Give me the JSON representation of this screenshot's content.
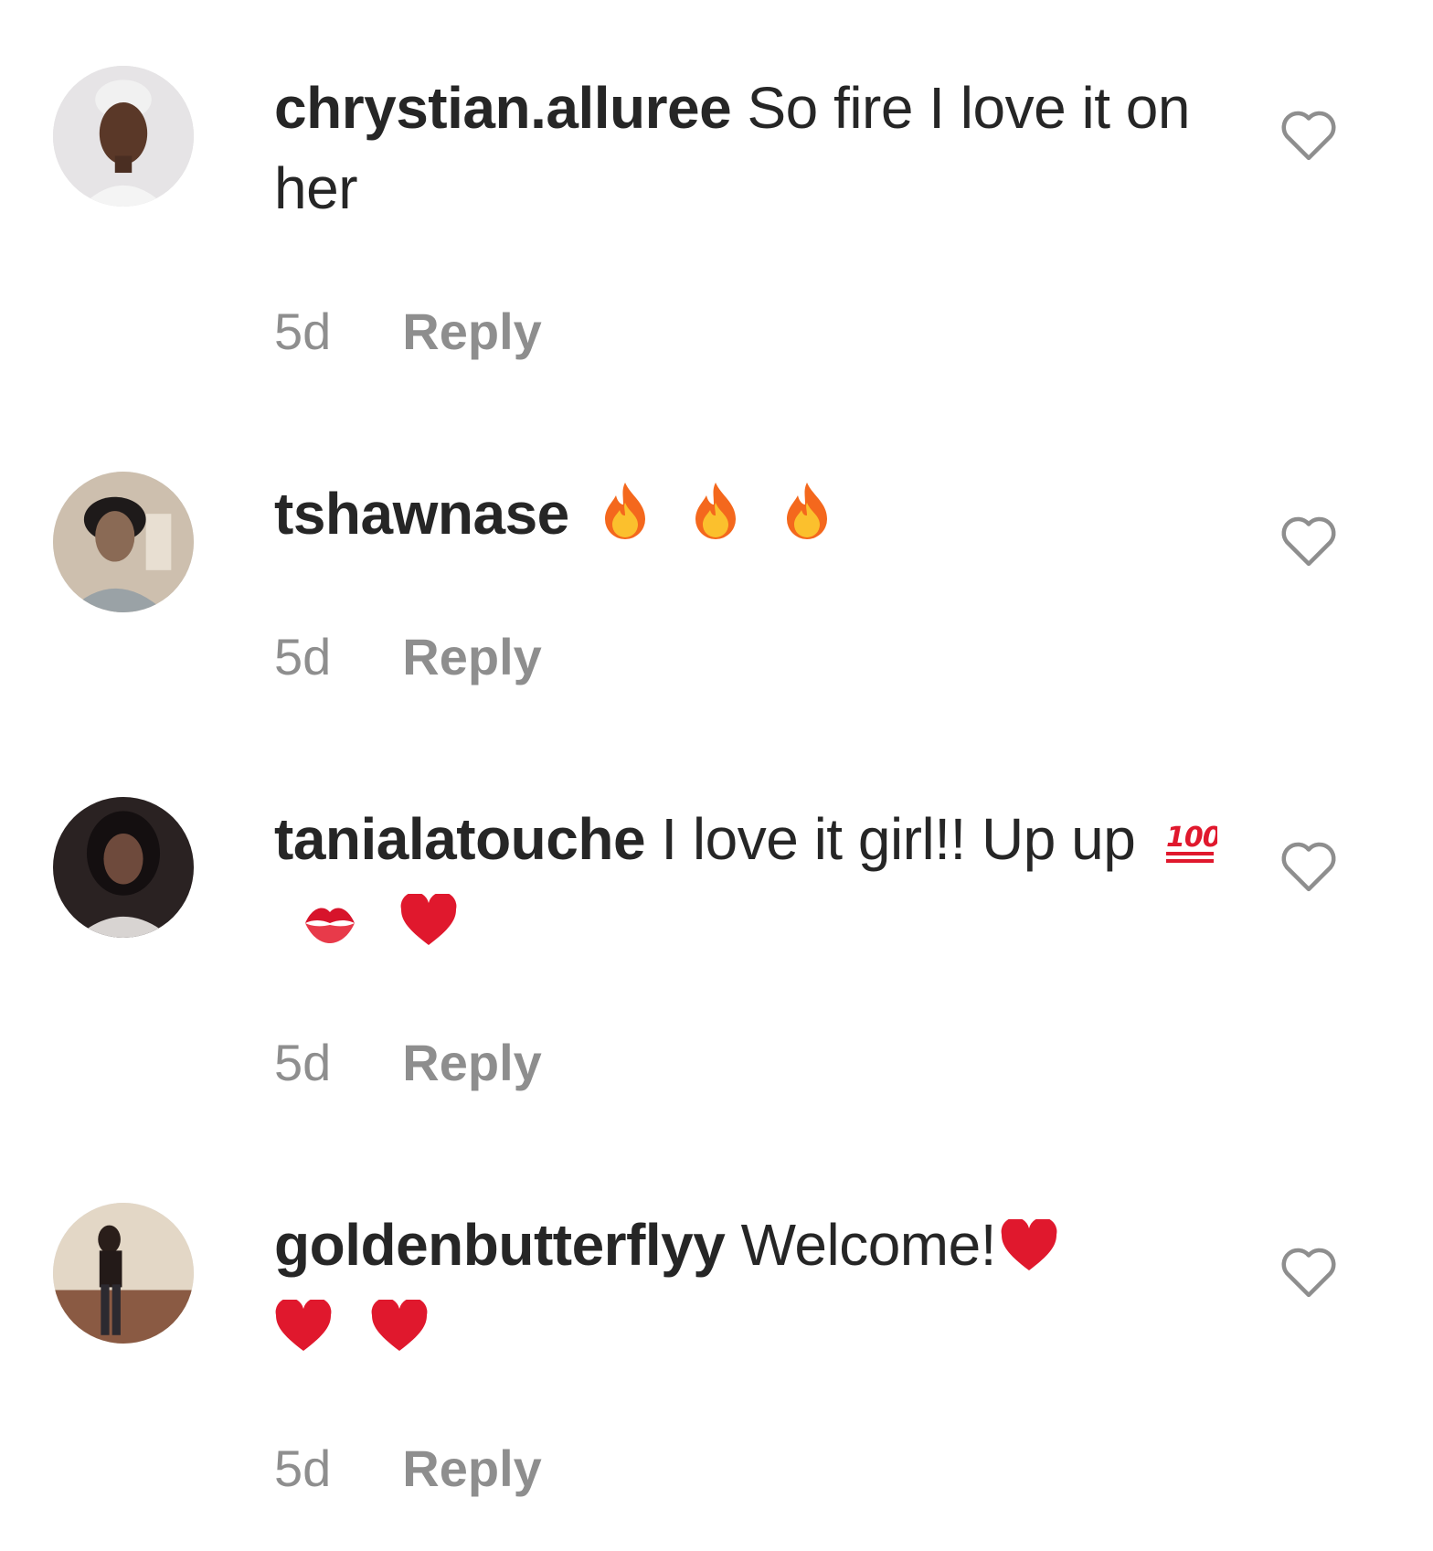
{
  "comments": [
    {
      "username": "chrystian.alluree",
      "text": "So fire I love it on her",
      "time": "5d",
      "reply_label": "Reply"
    },
    {
      "username": "tshawnase",
      "text": "",
      "emojis": [
        "fire",
        "fire",
        "fire"
      ],
      "time": "5d",
      "reply_label": "Reply"
    },
    {
      "username": "tanialatouche",
      "text": "I love it girl!! Up up",
      "emojis": [
        "hundred-points",
        "kiss-mark",
        "red-heart"
      ],
      "time": "5d",
      "reply_label": "Reply"
    },
    {
      "username": "goldenbutterflyy",
      "text": "Welcome!",
      "emojis": [
        "red-heart",
        "red-heart",
        "red-heart"
      ],
      "time": "5d",
      "reply_label": "Reply"
    }
  ],
  "colors": {
    "text": "#262626",
    "muted": "#8e8e8e",
    "heart_outline": "#8e8e8e",
    "emoji_red": "#e0182d",
    "emoji_fire": "#f9891e"
  }
}
